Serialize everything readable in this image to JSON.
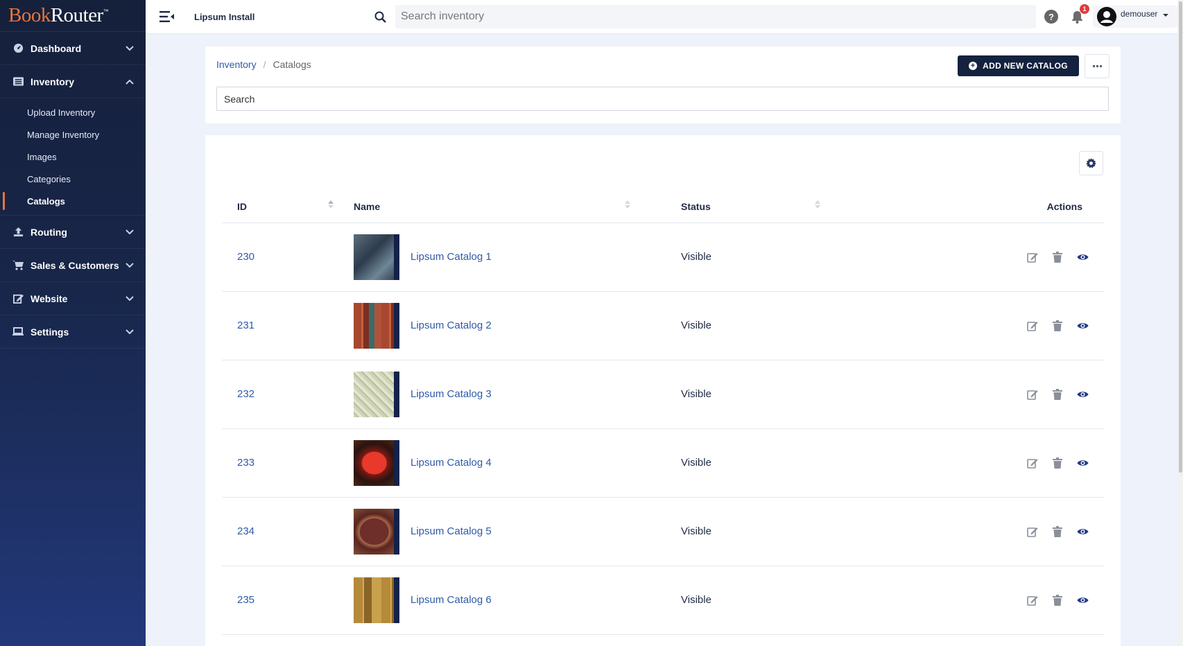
{
  "brand": {
    "part1": "Book",
    "part2": "Router",
    "tm": "™"
  },
  "sidebar": {
    "items": [
      {
        "label": "Dashboard",
        "icon": "dashboard-icon",
        "expanded": false
      },
      {
        "label": "Inventory",
        "icon": "inventory-list-icon",
        "expanded": true,
        "children": [
          "Upload Inventory",
          "Manage Inventory",
          "Images",
          "Categories",
          "Catalogs"
        ],
        "active_child": "Catalogs"
      },
      {
        "label": "Routing",
        "icon": "upload-icon",
        "expanded": false
      },
      {
        "label": "Sales & Customers",
        "icon": "cart-icon",
        "expanded": false
      },
      {
        "label": "Website",
        "icon": "edit-icon",
        "expanded": false
      },
      {
        "label": "Settings",
        "icon": "laptop-icon",
        "expanded": false
      }
    ]
  },
  "topbar": {
    "install_name": "Lipsum Install",
    "search_placeholder": "Search inventory",
    "help_label": "?",
    "notification_count": "1",
    "username": "demouser"
  },
  "header": {
    "breadcrumb": {
      "parent": "Inventory",
      "separator": "/",
      "current": "Catalogs"
    },
    "add_button_label": "ADD NEW CATALOG",
    "search_placeholder": "Search"
  },
  "table": {
    "columns": {
      "id": "ID",
      "name": "Name",
      "status": "Status",
      "actions": "Actions"
    },
    "rows": [
      {
        "id": "230",
        "name": "Lipsum Catalog 1",
        "status": "Visible"
      },
      {
        "id": "231",
        "name": "Lipsum Catalog 2",
        "status": "Visible"
      },
      {
        "id": "232",
        "name": "Lipsum Catalog 3",
        "status": "Visible"
      },
      {
        "id": "233",
        "name": "Lipsum Catalog 4",
        "status": "Visible"
      },
      {
        "id": "234",
        "name": "Lipsum Catalog 5",
        "status": "Visible"
      },
      {
        "id": "235",
        "name": "Lipsum Catalog 6",
        "status": "Visible"
      }
    ]
  },
  "colors": {
    "sidebar_bg": "#15203b",
    "accent": "#e8763a",
    "link": "#2e5aa7",
    "button_dark": "#14223f"
  }
}
